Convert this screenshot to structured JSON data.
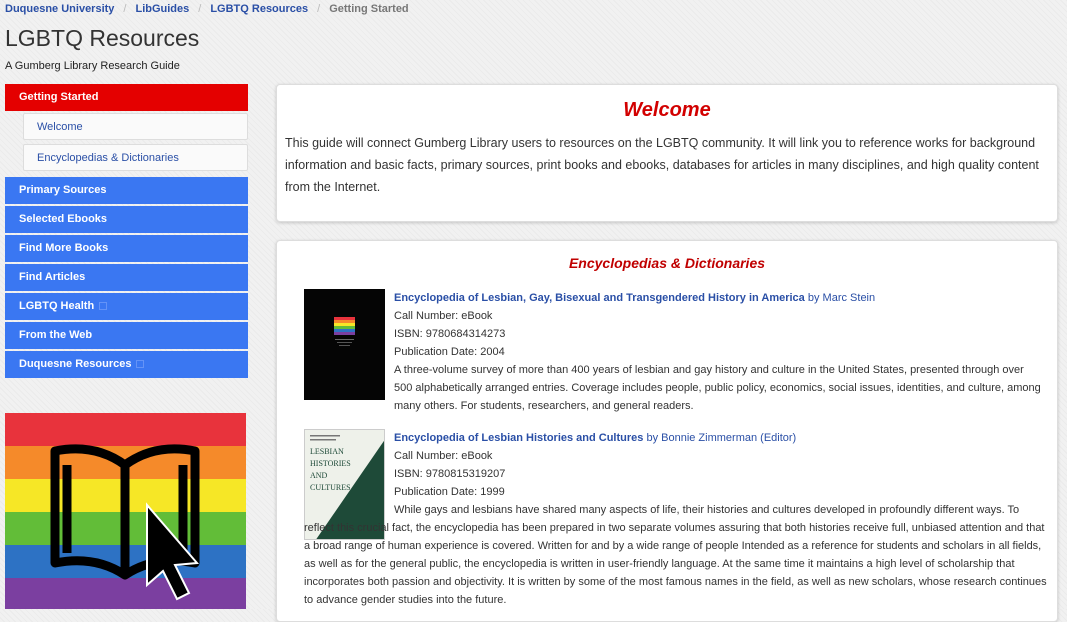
{
  "breadcrumb": [
    "Duquesne University",
    "LibGuides",
    "LGBTQ Resources",
    "Getting Started"
  ],
  "guide": {
    "title": "LGBTQ Resources",
    "subtitle": "A Gumberg Library Research Guide"
  },
  "nav": {
    "active": "Getting Started",
    "subitems": [
      "Welcome",
      "Encyclopedias & Dictionaries"
    ],
    "items": [
      "Primary Sources",
      "Selected Ebooks",
      "Find More Books",
      "Find Articles",
      "LGBTQ Health",
      "From the Web",
      "Duquesne Resources"
    ]
  },
  "banner": {
    "stripe_colors": [
      "#e8333c",
      "#f58a2a",
      "#f6e726",
      "#62bd38",
      "#2d72c4",
      "#7b3fa0"
    ]
  },
  "welcome": {
    "heading": "Welcome",
    "text": "This guide will connect Gumberg Library users to resources on the LGBTQ community. It will link you to reference works for background information and basic facts, primary sources, print books and ebooks, databases for articles in many disciplines, and high quality content from the Internet."
  },
  "encyclopedias": {
    "heading": "Encyclopedias & Dictionaries",
    "books": [
      {
        "title": "Encyclopedia of Lesbian, Gay, Bisexual and Transgendered History in America",
        "author": "by Marc Stein",
        "call": "Call Number: eBook",
        "isbn": "ISBN: 9780684314273",
        "date": "Publication Date: 2004",
        "desc": "A three-volume survey of more than 400 years of lesbian and gay history and culture in the United States, presented through over 500 alphabetically arranged entries. Coverage includes people, public policy, economics, social issues, identities, and culture, among many others. For students, researchers, and general readers."
      },
      {
        "title": "Encyclopedia of Lesbian Histories and Cultures",
        "author": "by Bonnie Zimmerman (Editor)",
        "call": "Call Number: eBook",
        "isbn": "ISBN: 9780815319207",
        "date": "Publication Date: 1999",
        "cover_title": "LESBIAN HISTORIES AND CULTURES",
        "desc": "While gays and lesbians have shared many aspects of life, their histories and cultures developed in profoundly different ways. To reflect this crucial fact, the encyclopedia has been prepared in two separate volumes assuring that both histories receive full, unbiased attention and that a broad range of human experience is covered. Written for and by a wide range of people Intended as a reference for students and scholars in all fields, as well as for the general public, the encyclopedia is written in user-friendly language. At the same time it maintains a high level of scholarship that incorporates both passion and objectivity. It is written by some of the most famous names in the field, as well as new scholars, whose research continues to advance gender studies into the future."
      }
    ]
  },
  "colors": {
    "link": "#2a4fa6",
    "nav_blue": "#3a77f2",
    "active_red": "#e40000",
    "heading_red": "#d20000"
  }
}
